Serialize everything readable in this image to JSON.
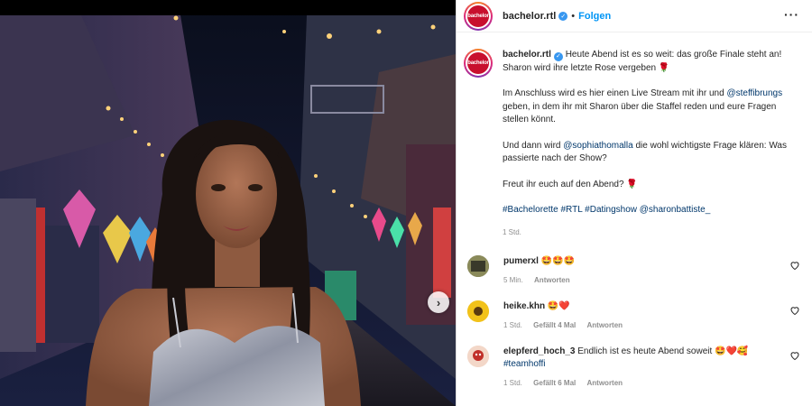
{
  "post": {
    "username": "bachelor.rtl",
    "follow_label": "Folgen",
    "avatar_text": "bachelor",
    "caption": {
      "line1": "Heute Abend ist es so weit: das große Finale steht an! Sharon wird ihre letzte Rose vergeben 🌹",
      "p2_a": "Im Anschluss wird es hier einen Live Stream mit ihr und",
      "p2_mention": "@steffibrungs",
      "p2_b": "geben, in dem ihr mit Sharon über die Staffel reden und eure Fragen stellen könnt.",
      "p3_a": "Und dann wird",
      "p3_mention": "@sophiathomalla",
      "p3_b": "die wohl wichtigste Frage klären: Was passierte nach der Show?",
      "p4": "Freut ihr euch auf den Abend? 🌹",
      "tags": "#Bachelorette #RTL #Datingshow @sharonbattiste_"
    },
    "timestamp": "1 Std."
  },
  "comments": [
    {
      "user": "pumerxl",
      "text": "🤩🤩🤩",
      "time": "5 Min.",
      "likes": "",
      "reply": "Antworten"
    },
    {
      "user": "heike.khn",
      "text": "🤩❤️",
      "time": "1 Std.",
      "likes": "Gefällt 4 Mal",
      "reply": "Antworten"
    },
    {
      "user": "elepferd_hoch_3",
      "text": "Endlich ist es heute Abend soweit 🤩❤️🥰",
      "tag": "#teamhoffi",
      "time": "1 Std.",
      "likes": "Gefällt 6 Mal",
      "reply": "Antworten"
    }
  ],
  "colors": {
    "link": "#00376b",
    "follow": "#0095f6",
    "verified": "#3897f0",
    "brand": "#c8102e"
  }
}
